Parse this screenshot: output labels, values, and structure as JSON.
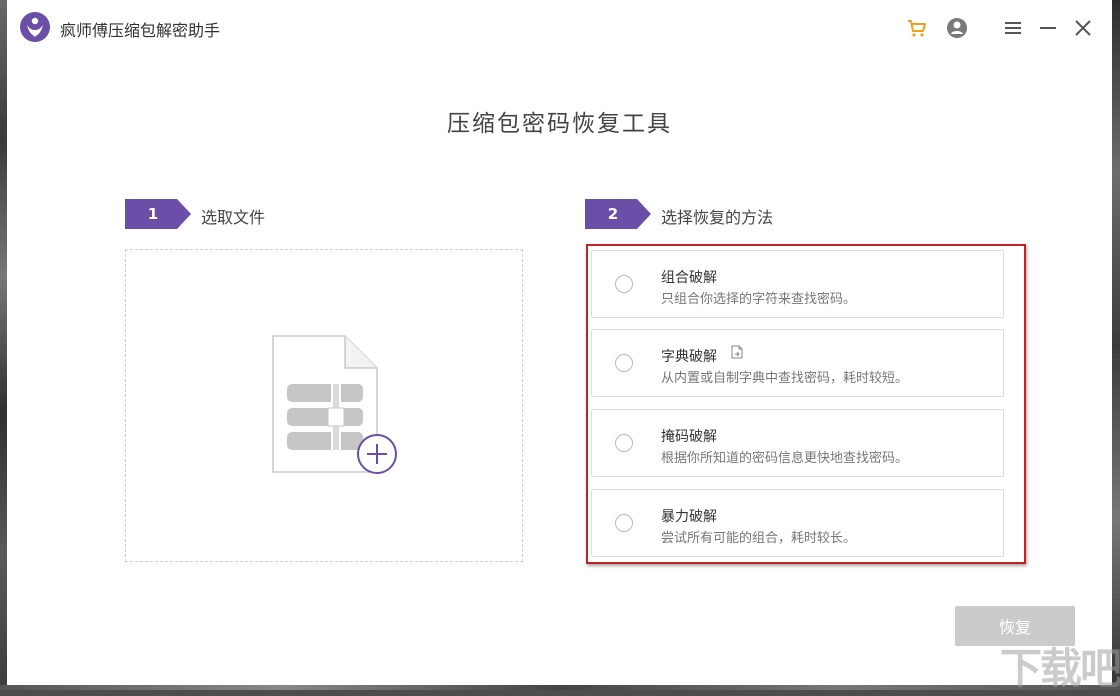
{
  "window": {
    "title": "疯师傅压缩包解密助手"
  },
  "titlebar": {
    "cart_icon": "cart-icon",
    "user_icon": "user-icon",
    "menu_icon": "hamburger-menu-icon",
    "minimize_icon": "minimize-icon",
    "close_icon": "close-icon"
  },
  "main": {
    "heading": "压缩包密码恢复工具",
    "step1": {
      "number": "1",
      "label": "选取文件"
    },
    "step2": {
      "number": "2",
      "label": "选择恢复的方法"
    },
    "methods": [
      {
        "title": "组合破解",
        "desc": "只组合你选择的字符来查找密码。"
      },
      {
        "title": "字典破解",
        "desc": "从内置或自制字典中查找密码，耗时较短。"
      },
      {
        "title": "掩码破解",
        "desc": "根据你所知道的密码信息更快地查找密码。"
      },
      {
        "title": "暴力破解",
        "desc": "尝试所有可能的组合，耗时较长。"
      }
    ],
    "restore_label": "恢复"
  },
  "watermark": "下载吧",
  "colors": {
    "accent": "#6b4ea8",
    "highlight": "#c0242a",
    "cart": "#f0a020",
    "disabled_button": "#cbcbcb"
  }
}
